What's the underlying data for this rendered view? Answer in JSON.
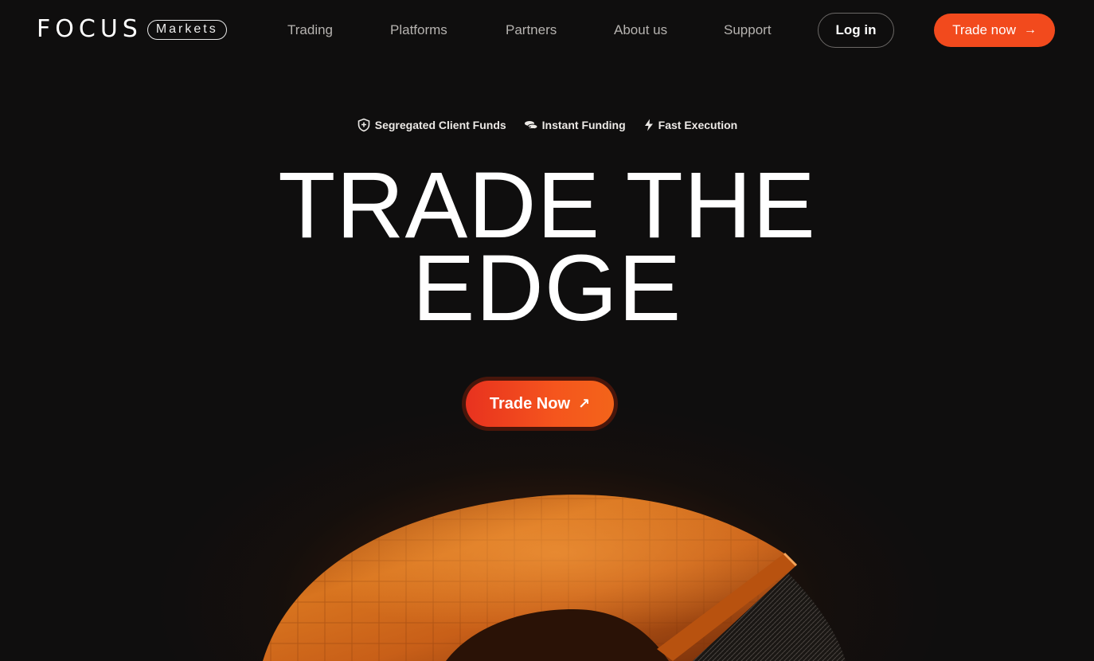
{
  "brand": {
    "name": "FOCUS",
    "tag": "Markets"
  },
  "nav": {
    "links": [
      "Trading",
      "Platforms",
      "Partners",
      "About us",
      "Support"
    ],
    "login": "Log in",
    "trade_now": "Trade now"
  },
  "features": [
    {
      "icon": "shield-plus-icon",
      "label": "Segregated Client Funds"
    },
    {
      "icon": "coins-icon",
      "label": "Instant Funding"
    },
    {
      "icon": "lightning-icon",
      "label": "Fast Execution"
    }
  ],
  "hero": {
    "title_line1": "TRADE THE",
    "title_line2": "EDGE",
    "cta": "Trade Now"
  },
  "colors": {
    "accent": "#f24a1d",
    "background": "#0f0e0e",
    "copper": "#c8621f"
  }
}
